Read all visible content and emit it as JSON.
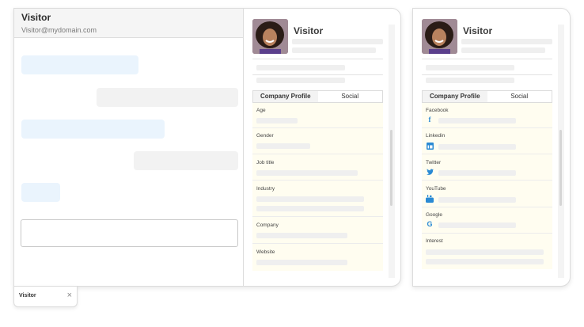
{
  "chat": {
    "title": "Visitor",
    "email": "Visitor@mydomain.com",
    "input_placeholder": ""
  },
  "profile": {
    "name": "Visitor",
    "tabs": [
      "Company Profile",
      "Social"
    ],
    "fields": [
      "Age",
      "Gender",
      "Job title",
      "Industry",
      "Company",
      "Website"
    ]
  },
  "profile_social": {
    "name": "Visitor",
    "tabs": [
      "Company Profile",
      "Social"
    ],
    "fields": [
      "Facebook",
      "Linkedin",
      "Twitter",
      "YouTube",
      "Google",
      "Interest"
    ]
  },
  "minimized": {
    "label": "Visitor",
    "close": "×"
  },
  "icons": {
    "facebook": "facebook-icon",
    "linkedin": "linkedin-icon",
    "twitter": "twitter-icon",
    "youtube": "youtube-icon",
    "google": "google-icon"
  },
  "colors": {
    "field_bg": "#fffdf0",
    "incoming_bubble": "#eaf4fd",
    "outgoing_bubble": "#f2f2f2",
    "social_blue": "#2a8ad4"
  }
}
